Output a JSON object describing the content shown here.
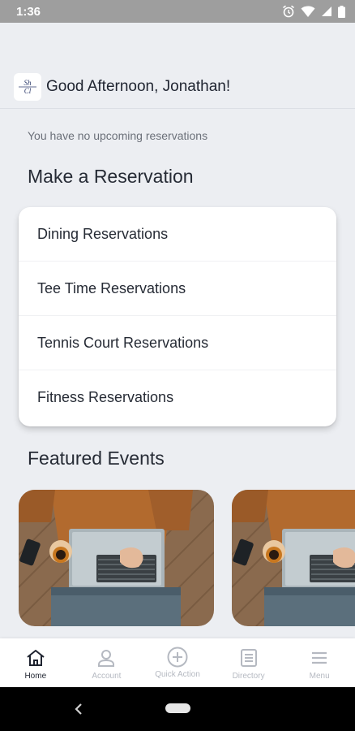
{
  "status_bar": {
    "time": "1:36",
    "icons": [
      "alarm-icon",
      "wifi-icon",
      "signal-icon",
      "battery-icon"
    ]
  },
  "header": {
    "greeting": "Good Afternoon, Jonathan!"
  },
  "reservations": {
    "empty_message": "You have no upcoming reservations",
    "section_title": "Make a Reservation",
    "items": [
      {
        "label": "Dining Reservations"
      },
      {
        "label": "Tee Time Reservations"
      },
      {
        "label": "Tennis Court Reservations"
      },
      {
        "label": "Fitness Reservations"
      }
    ]
  },
  "events": {
    "section_title": "Featured Events",
    "cards": [
      {
        "image": "laptop-coffee-photo"
      },
      {
        "image": "laptop-coffee-photo"
      }
    ]
  },
  "bottom_nav": {
    "items": [
      {
        "label": "Home",
        "icon": "home-icon",
        "active": true
      },
      {
        "label": "Account",
        "icon": "account-icon",
        "active": false
      },
      {
        "label": "Quick Action",
        "icon": "plus-circle-icon",
        "active": false
      },
      {
        "label": "Directory",
        "icon": "directory-icon",
        "active": false
      },
      {
        "label": "Menu",
        "icon": "menu-icon",
        "active": false
      }
    ]
  },
  "colors": {
    "background": "#eceef2",
    "card": "#ffffff",
    "status_bar": "#9e9e9e",
    "text_primary": "#262b35",
    "text_muted": "#6b7079",
    "nav_inactive": "#b5b9c1"
  }
}
